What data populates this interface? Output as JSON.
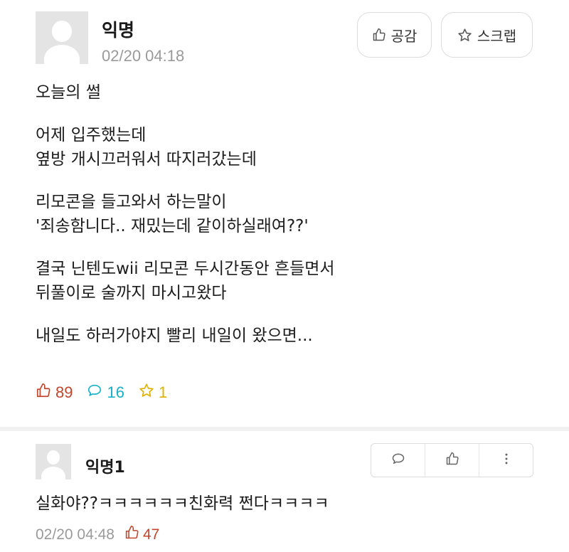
{
  "post": {
    "author": "익명",
    "date": "02/20 04:18",
    "like_button_label": "공감",
    "scrap_button_label": "스크랩",
    "content": [
      [
        "오늘의 썰"
      ],
      [
        "어제 입주했는데",
        "옆방 개시끄러워서 따지러갔는데"
      ],
      [
        "리모콘을 들고와서 하는말이",
        "'죄송함니다.. 재밌는데 같이하실래여??'"
      ],
      [
        "결국 닌텐도wii 리모콘 두시간동안 흔들면서",
        "뒤풀이로 술까지 마시고왔다"
      ],
      [
        "내일도 하러가야지 빨리 내일이 왔으면..."
      ]
    ],
    "stats": {
      "likes": "89",
      "comments": "16",
      "scraps": "1"
    }
  },
  "comment": {
    "author": "익명1",
    "text": "실화야??ㅋㅋㅋㅋㅋㅋ친화력 쩐다ㅋㅋㅋㅋ",
    "date": "02/20 04:48",
    "likes": "47"
  },
  "icons": {
    "thumb": "thumbs-up-icon",
    "star": "star-icon",
    "bubble": "comment-bubble-icon",
    "more": "more-vertical-icon"
  },
  "colors": {
    "likes": "#c2462b",
    "comments": "#18b1c9",
    "scraps": "#e0b100",
    "date": "#9a9a9a"
  }
}
